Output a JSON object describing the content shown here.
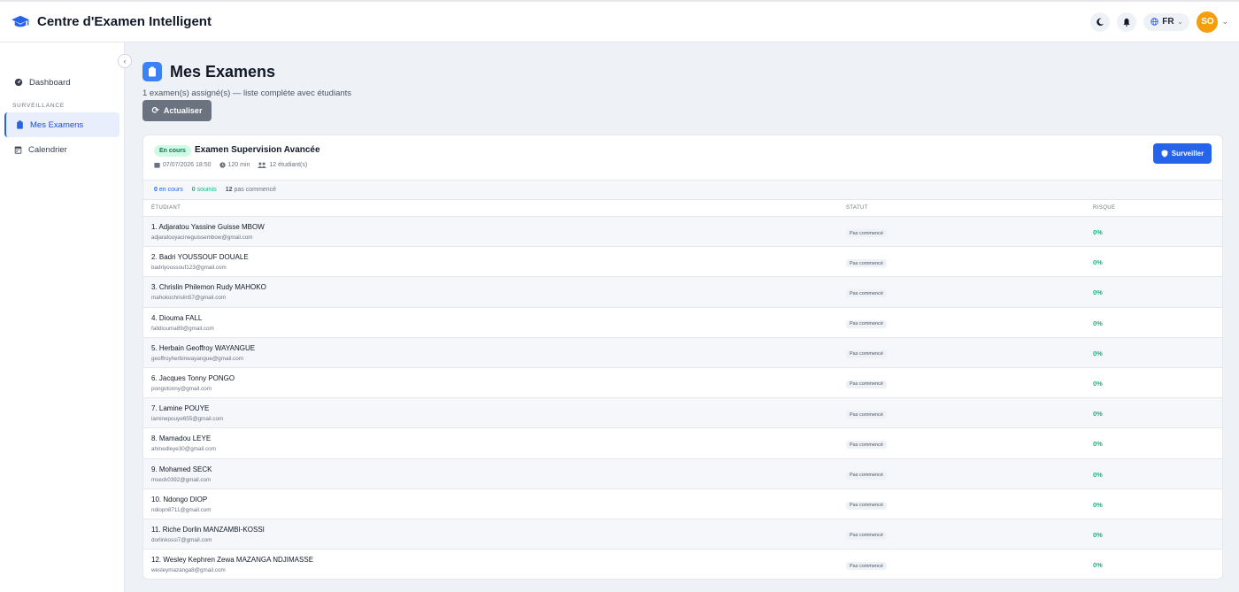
{
  "app": {
    "title": "Centre d'Examen Intelligent"
  },
  "header": {
    "lang": "FR",
    "avatar_initials": "SO"
  },
  "sidebar": {
    "items": [
      {
        "label": "Dashboard",
        "icon": "gauge-icon"
      },
      {
        "label": "Mes Examens",
        "icon": "clipboard-icon"
      },
      {
        "label": "Calendrier",
        "icon": "calendar-icon"
      }
    ],
    "section_label": "SURVEILLANCE"
  },
  "page": {
    "title": "Mes Examens",
    "subtitle": "1 examen(s) assigné(s) — liste complète avec étudiants",
    "refresh_label": "Actualiser"
  },
  "exam": {
    "status": "En cours",
    "title": "Examen Supervision Avancée",
    "date": "07/07/2026 18:50",
    "duration": "120 min",
    "students": "12 étudiant(s)",
    "watch_label": "Surveiller",
    "stats": {
      "in_progress_count": "0",
      "in_progress_label": "en cours",
      "submitted_count": "0",
      "submitted_label": "soumis",
      "not_started_count": "12",
      "not_started_label": "pas commencé"
    },
    "columns": {
      "student": "ÉTUDIANT",
      "status": "STATUT",
      "risk": "RISQUE"
    },
    "rows": [
      {
        "name": "1. Adjaratou Yassine Guisse MBOW",
        "email": "adjaratouyacineguissembow@gmail.com",
        "status": "Pas commencé",
        "risk": "0%"
      },
      {
        "name": "2. Badri YOUSSOUF DOUALE",
        "email": "badriyoussouf123@gmail.com",
        "status": "Pas commencé",
        "risk": "0%"
      },
      {
        "name": "3. Chrislin Philemon Rudy MAHOKO",
        "email": "mahokochrislin57@gmail.com",
        "status": "Pas commencé",
        "risk": "0%"
      },
      {
        "name": "4. Diouma FALL",
        "email": "falldiouma89@gmail.com",
        "status": "Pas commencé",
        "risk": "0%"
      },
      {
        "name": "5. Herbain Geoffroy WAYANGUE",
        "email": "geoffroyherbinwayangue@gmail.com",
        "status": "Pas commencé",
        "risk": "0%"
      },
      {
        "name": "6. Jacques Tonny PONGO",
        "email": "pongotonny@gmail.com",
        "status": "Pas commencé",
        "risk": "0%"
      },
      {
        "name": "7. Lamine POUYE",
        "email": "laminepouye655@gmail.com",
        "status": "Pas commencé",
        "risk": "0%"
      },
      {
        "name": "8. Mamadou LEYE",
        "email": "ahmedleye30@gmail.com",
        "status": "Pas commencé",
        "risk": "0%"
      },
      {
        "name": "9. Mohamed SECK",
        "email": "mseck0392@gmail.com",
        "status": "Pas commencé",
        "risk": "0%"
      },
      {
        "name": "10. Ndongo DIOP",
        "email": "ndiopn8711@gmail.com",
        "status": "Pas commencé",
        "risk": "0%"
      },
      {
        "name": "11. Riche Dorlin MANZAMBI-KOSSI",
        "email": "dorlinkossi7@gmail.com",
        "status": "Pas commencé",
        "risk": "0%"
      },
      {
        "name": "12. Wesley Kephren Zewa MAZANGA NDJIMASSE",
        "email": "wesleymazanga8@gmail.com",
        "status": "Pas commencé",
        "risk": "0%"
      }
    ]
  },
  "colors": {
    "primary": "#2563eb",
    "success": "#10b981",
    "avatar": "#f59e0b"
  }
}
